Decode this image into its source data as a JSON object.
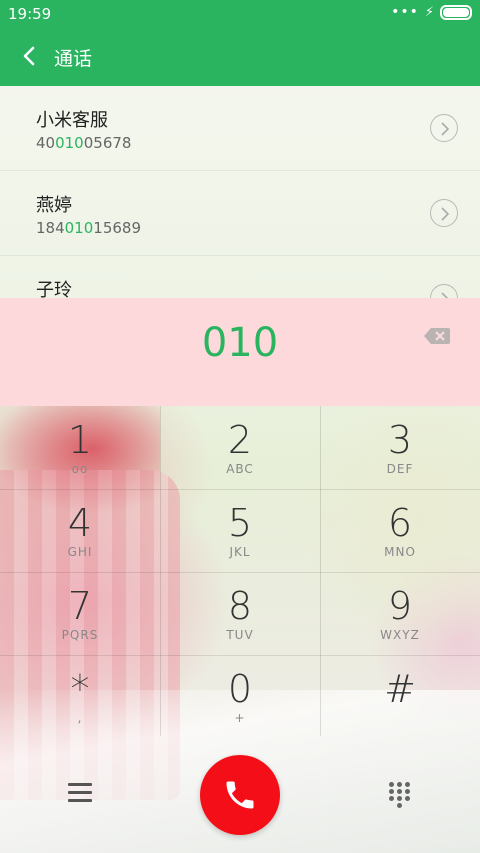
{
  "status": {
    "time": "19:59"
  },
  "header": {
    "title": "通话"
  },
  "contacts": [
    {
      "name": "小米客服",
      "number_pre": "40",
      "number_hl": "010",
      "number_post": "05678"
    },
    {
      "name": "燕婷",
      "number_pre": "184",
      "number_hl": "010",
      "number_post": "15689"
    },
    {
      "name": "子玲",
      "number_pre": "",
      "number_hl": "",
      "number_post": ""
    }
  ],
  "dial": {
    "digits": "010"
  },
  "keypad": [
    {
      "digit": "1",
      "letters": "oo"
    },
    {
      "digit": "2",
      "letters": "ABC"
    },
    {
      "digit": "3",
      "letters": "DEF"
    },
    {
      "digit": "4",
      "letters": "GHI"
    },
    {
      "digit": "5",
      "letters": "JKL"
    },
    {
      "digit": "6",
      "letters": "MNO"
    },
    {
      "digit": "7",
      "letters": "PQRS"
    },
    {
      "digit": "8",
      "letters": "TUV"
    },
    {
      "digit": "9",
      "letters": "WXYZ"
    },
    {
      "digit": "*",
      "letters": ","
    },
    {
      "digit": "0",
      "letters": "+"
    },
    {
      "digit": "#",
      "letters": ""
    }
  ],
  "colors": {
    "accent": "#2bb45f",
    "call": "#f40f18",
    "input_bg": "#fdd9dc"
  },
  "icons": {
    "back": "back-arrow-icon",
    "delete": "backspace-icon",
    "menu": "menu-icon",
    "call": "phone-icon",
    "keypad": "dialpad-icon"
  }
}
